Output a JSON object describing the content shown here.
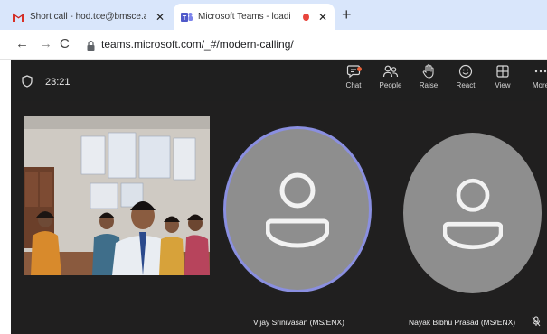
{
  "browser": {
    "tabs": [
      {
        "title": "Short call - hod.tce@bmsce.ac.in - B",
        "icon": "gmail-icon",
        "active": false
      },
      {
        "title": "Microsoft Teams - loading",
        "icon": "teams-icon",
        "active": true
      }
    ],
    "new_tab": "+",
    "url": "teams.microsoft.com/_#/modern-calling/"
  },
  "meeting": {
    "timer": "23:21",
    "toolbar": [
      {
        "key": "chat",
        "label": "Chat",
        "icon": "chat-icon"
      },
      {
        "key": "people",
        "label": "People",
        "icon": "people-icon"
      },
      {
        "key": "raise",
        "label": "Raise",
        "icon": "hand-icon"
      },
      {
        "key": "react",
        "label": "React",
        "icon": "smiley-icon"
      },
      {
        "key": "view",
        "label": "View",
        "icon": "grid-icon"
      },
      {
        "key": "more",
        "label": "More",
        "icon": "more-icon"
      }
    ],
    "participants": [
      {
        "name": "Vijay Srinivasan (MS/ENX)",
        "speaking": true,
        "muted": false
      },
      {
        "name": "Nayak Bibhu Prasad (MS/ENX)",
        "speaking": false,
        "muted": true
      }
    ],
    "colors": {
      "background": "#201f1f",
      "avatar": "#8e8e8e",
      "speaking_ring": "#8a8fe0"
    }
  }
}
